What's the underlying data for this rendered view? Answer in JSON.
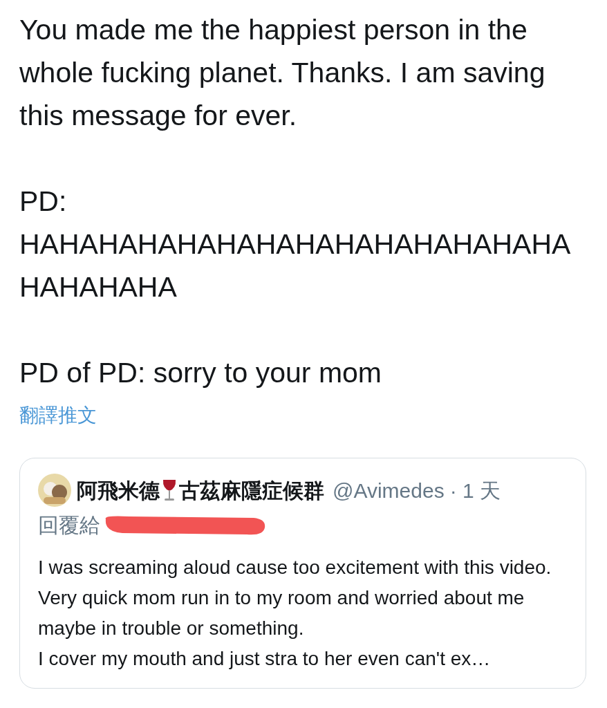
{
  "tweet": {
    "paragraphs": [
      "You made me the happiest person in the whole fucking planet. Thanks. I am saving this message for ever.",
      "PD: HAHAHAHAHAHAHAHAHAHAHAHAHAHAHAHAHAHA",
      "PD of PD: sorry to your mom"
    ],
    "translate_link": "翻譯推文"
  },
  "quoted_tweet": {
    "name_parts": [
      "阿飛米德",
      "古茲麻隱症候群"
    ],
    "handle": "@Avimedes",
    "time": "· 1 天",
    "reply_to": "回覆給",
    "text_lines": [
      "I was screaming aloud cause too excitement with this video.",
      "Very quick mom run in to my room and worried about me maybe in trouble or something.",
      "I cover my mouth and just stra to her even can't ex…"
    ]
  }
}
